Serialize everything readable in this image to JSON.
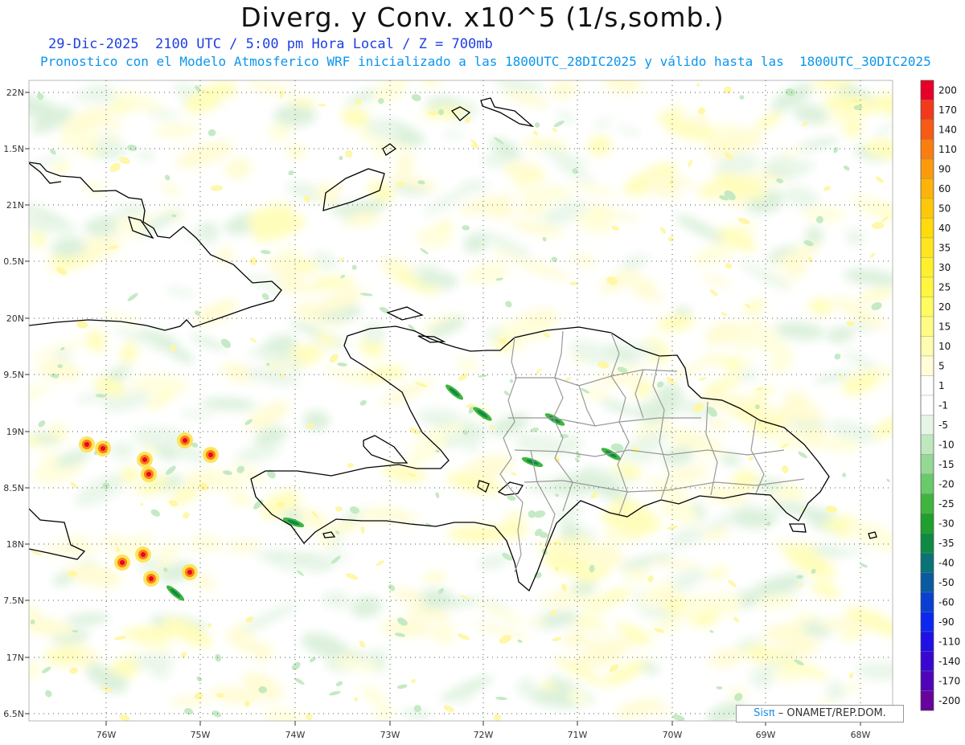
{
  "header": {
    "title": "Diverg. y Conv. x10^5 (1/s,somb.)",
    "valid_line": "29-Dic-2025  2100 UTC / 5:00 pm Hora Local / Z = 700mb",
    "model_line": "Pronostico con el Modelo Atmosferico WRF inicializado a las 1800UTC_28DIC2025 y válido hasta las  1800UTC_30DIC2025"
  },
  "axes": {
    "lat_labels": [
      "22N",
      "1.5N",
      "21N",
      "0.5N",
      "20N",
      "9.5N",
      "19N",
      "8.5N",
      "18N",
      "7.5N",
      "17N",
      "6.5N"
    ],
    "lon_labels": [
      "76W",
      "75W",
      "74W",
      "73W",
      "72W",
      "71W",
      "70W",
      "69W",
      "68W"
    ]
  },
  "legend": {
    "labels": [
      "200",
      "170",
      "140",
      "110",
      "90",
      "60",
      "50",
      "40",
      "35",
      "30",
      "25",
      "20",
      "15",
      "10",
      "5",
      "1",
      "-1",
      "-5",
      "-10",
      "-15",
      "-20",
      "-25",
      "-30",
      "-35",
      "-40",
      "-50",
      "-60",
      "-90",
      "-110",
      "-140",
      "-170",
      "-200"
    ],
    "colors": [
      "#e8002a",
      "#f23a1a",
      "#f75a14",
      "#fa7d10",
      "#fc9a0c",
      "#fdb40a",
      "#fec80a",
      "#ffdb0c",
      "#ffe61e",
      "#fff02e",
      "#fff63f",
      "#fffb60",
      "#fffc86",
      "#fffdaf",
      "#fffed6",
      "#ffffff",
      "#ffffff",
      "#e6f5e6",
      "#bfe8bf",
      "#94d894",
      "#6ac96a",
      "#3fb53f",
      "#1f9f2b",
      "#0f8a45",
      "#0a7375",
      "#0a5a9f",
      "#0a40cf",
      "#0a28f0",
      "#2010e6",
      "#3808d0",
      "#5006b8",
      "#66049c"
    ]
  },
  "credit": {
    "logo": "Sisπ",
    "text": "– ONAMET/REP.DOM."
  },
  "colors": {
    "coast": "#000000",
    "provinces": "#999999",
    "grid": "#555555"
  }
}
